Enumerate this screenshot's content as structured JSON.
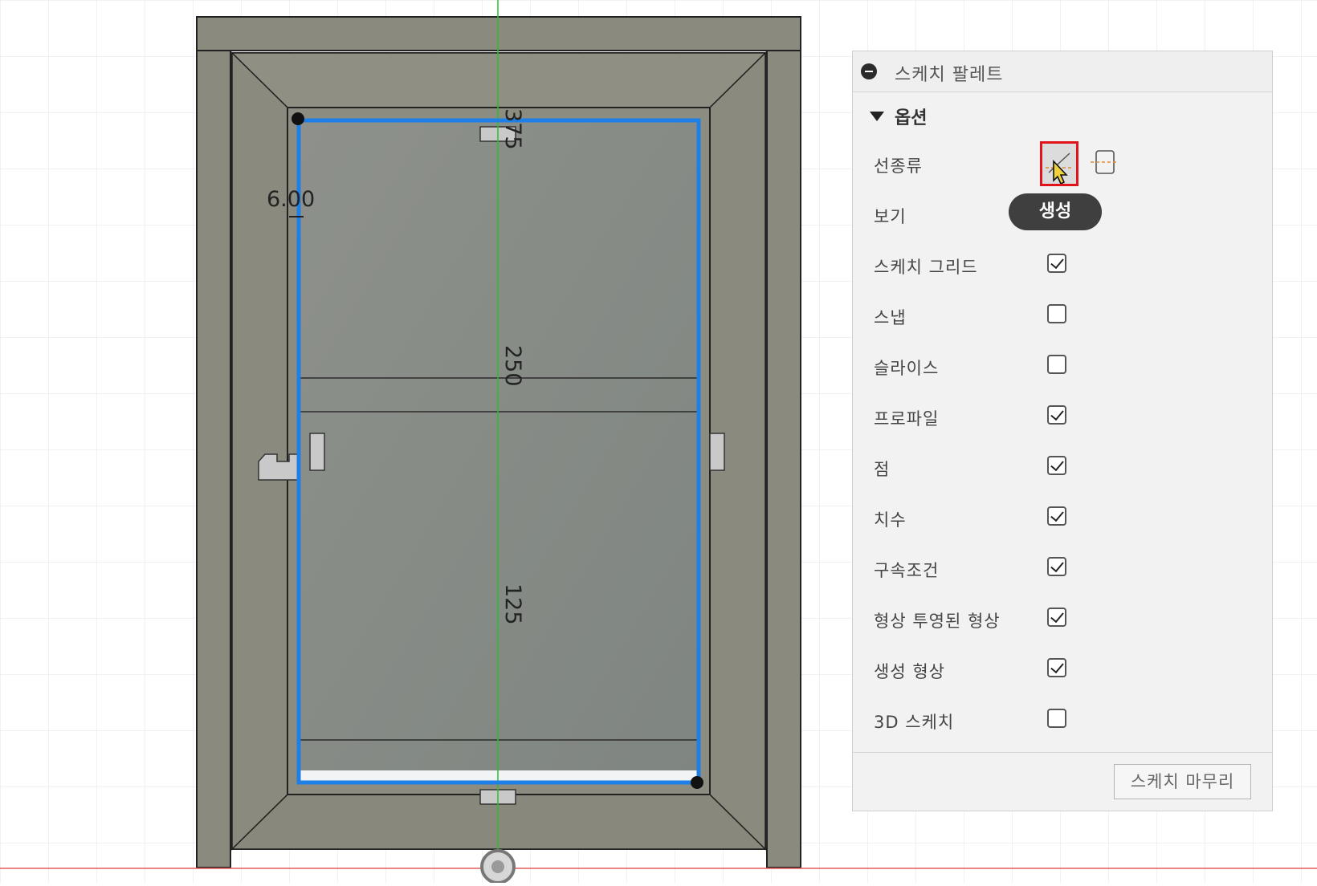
{
  "viewport": {
    "dimension_labels": {
      "top": "375",
      "middle": "250",
      "lower": "125",
      "offset": "6.00"
    }
  },
  "palette": {
    "title": "스케치 팔레트",
    "options_label": "옵션",
    "rows": [
      {
        "label": "선종류",
        "kind": "buttons"
      },
      {
        "label": "보기",
        "kind": "none"
      },
      {
        "label": "스케치 그리드",
        "checked": true
      },
      {
        "label": "스냅",
        "checked": false
      },
      {
        "label": "슬라이스",
        "checked": false
      },
      {
        "label": "프로파일",
        "checked": true
      },
      {
        "label": "점",
        "checked": true
      },
      {
        "label": "치수",
        "checked": true
      },
      {
        "label": "구속조건",
        "checked": true
      },
      {
        "label": "형상 투영된 형상",
        "checked": true
      },
      {
        "label": "생성 형상",
        "checked": true
      },
      {
        "label": "3D 스케치",
        "checked": false
      }
    ],
    "tooltip": "생성",
    "finish_label": "스케치 마무리"
  },
  "icons": {
    "collapse": "minus-circle-icon",
    "caret": "caret-down-icon",
    "linetype": "construction-line-icon",
    "linetype_alt": "centerline-icon",
    "cursor": "mouse-pointer-icon"
  },
  "colors": {
    "selection_blue": "#1e7fe6",
    "highlight_red": "#e2141b",
    "axis_green": "#2ac02a",
    "axis_red": "#e65b5b",
    "frame_gray": "#8a8a7e"
  }
}
